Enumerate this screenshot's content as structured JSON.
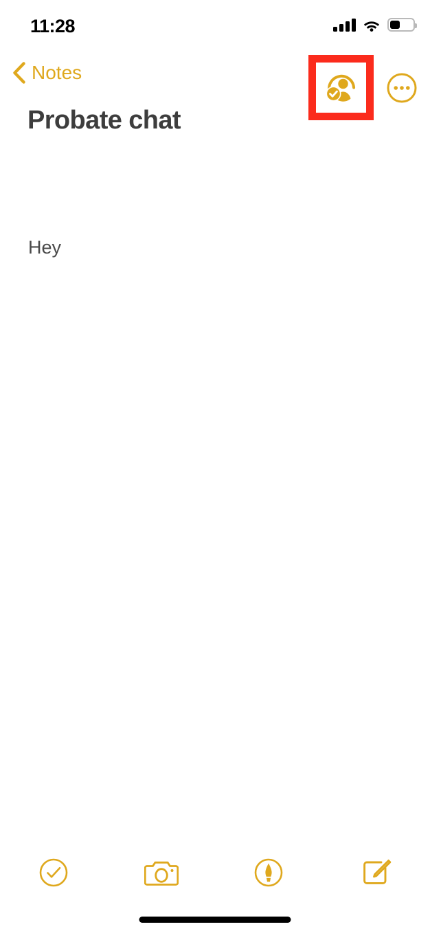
{
  "status_bar": {
    "time": "11:28",
    "cellular_icon": "cellular-signal-icon",
    "cellular_bars": 4,
    "wifi_icon": "wifi-icon",
    "battery_icon": "battery-icon",
    "battery_level_percent": 45
  },
  "nav_bar": {
    "back_icon": "chevron-left-icon",
    "back_label": "Notes",
    "collaborate_icon": "person-badge-check-icon",
    "collaborate_label": "Collaborate",
    "more_icon": "ellipsis-circle-icon",
    "more_label": "More"
  },
  "note": {
    "title": "Probate chat",
    "body": "Hey"
  },
  "toolbar": {
    "items": [
      {
        "icon": "checklist-circle-icon",
        "label": "Checklist"
      },
      {
        "icon": "camera-icon",
        "label": "Camera"
      },
      {
        "icon": "markup-pen-circle-icon",
        "label": "Markup"
      },
      {
        "icon": "compose-square-pencil-icon",
        "label": "Compose"
      }
    ]
  },
  "home_indicator": {
    "icon": "home-indicator-bar"
  },
  "colors": {
    "accent": "#DFA81D",
    "highlight": "#FB2B1C",
    "title_text": "#3D3D3D",
    "body_text": "#4A4A4A",
    "background": "#FFFFFF"
  }
}
